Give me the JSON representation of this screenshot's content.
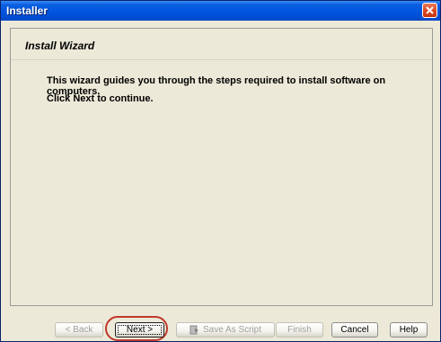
{
  "window": {
    "title": "Installer"
  },
  "wizard": {
    "heading": "Install Wizard",
    "description_line1": "This wizard guides you through the steps required to install software on computers.",
    "description_line2": "Click Next to continue."
  },
  "buttons": {
    "back": "< Back",
    "next": "Next >",
    "save_as_script": "Save As Script",
    "finish": "Finish",
    "cancel": "Cancel",
    "help": "Help"
  },
  "colors": {
    "titlebar": "#0053de",
    "window_bg": "#ece9d8",
    "highlight_ring": "#c0392b",
    "close_button": "#d9431a"
  },
  "icons": {
    "close": "close-icon",
    "script": "script-icon"
  }
}
